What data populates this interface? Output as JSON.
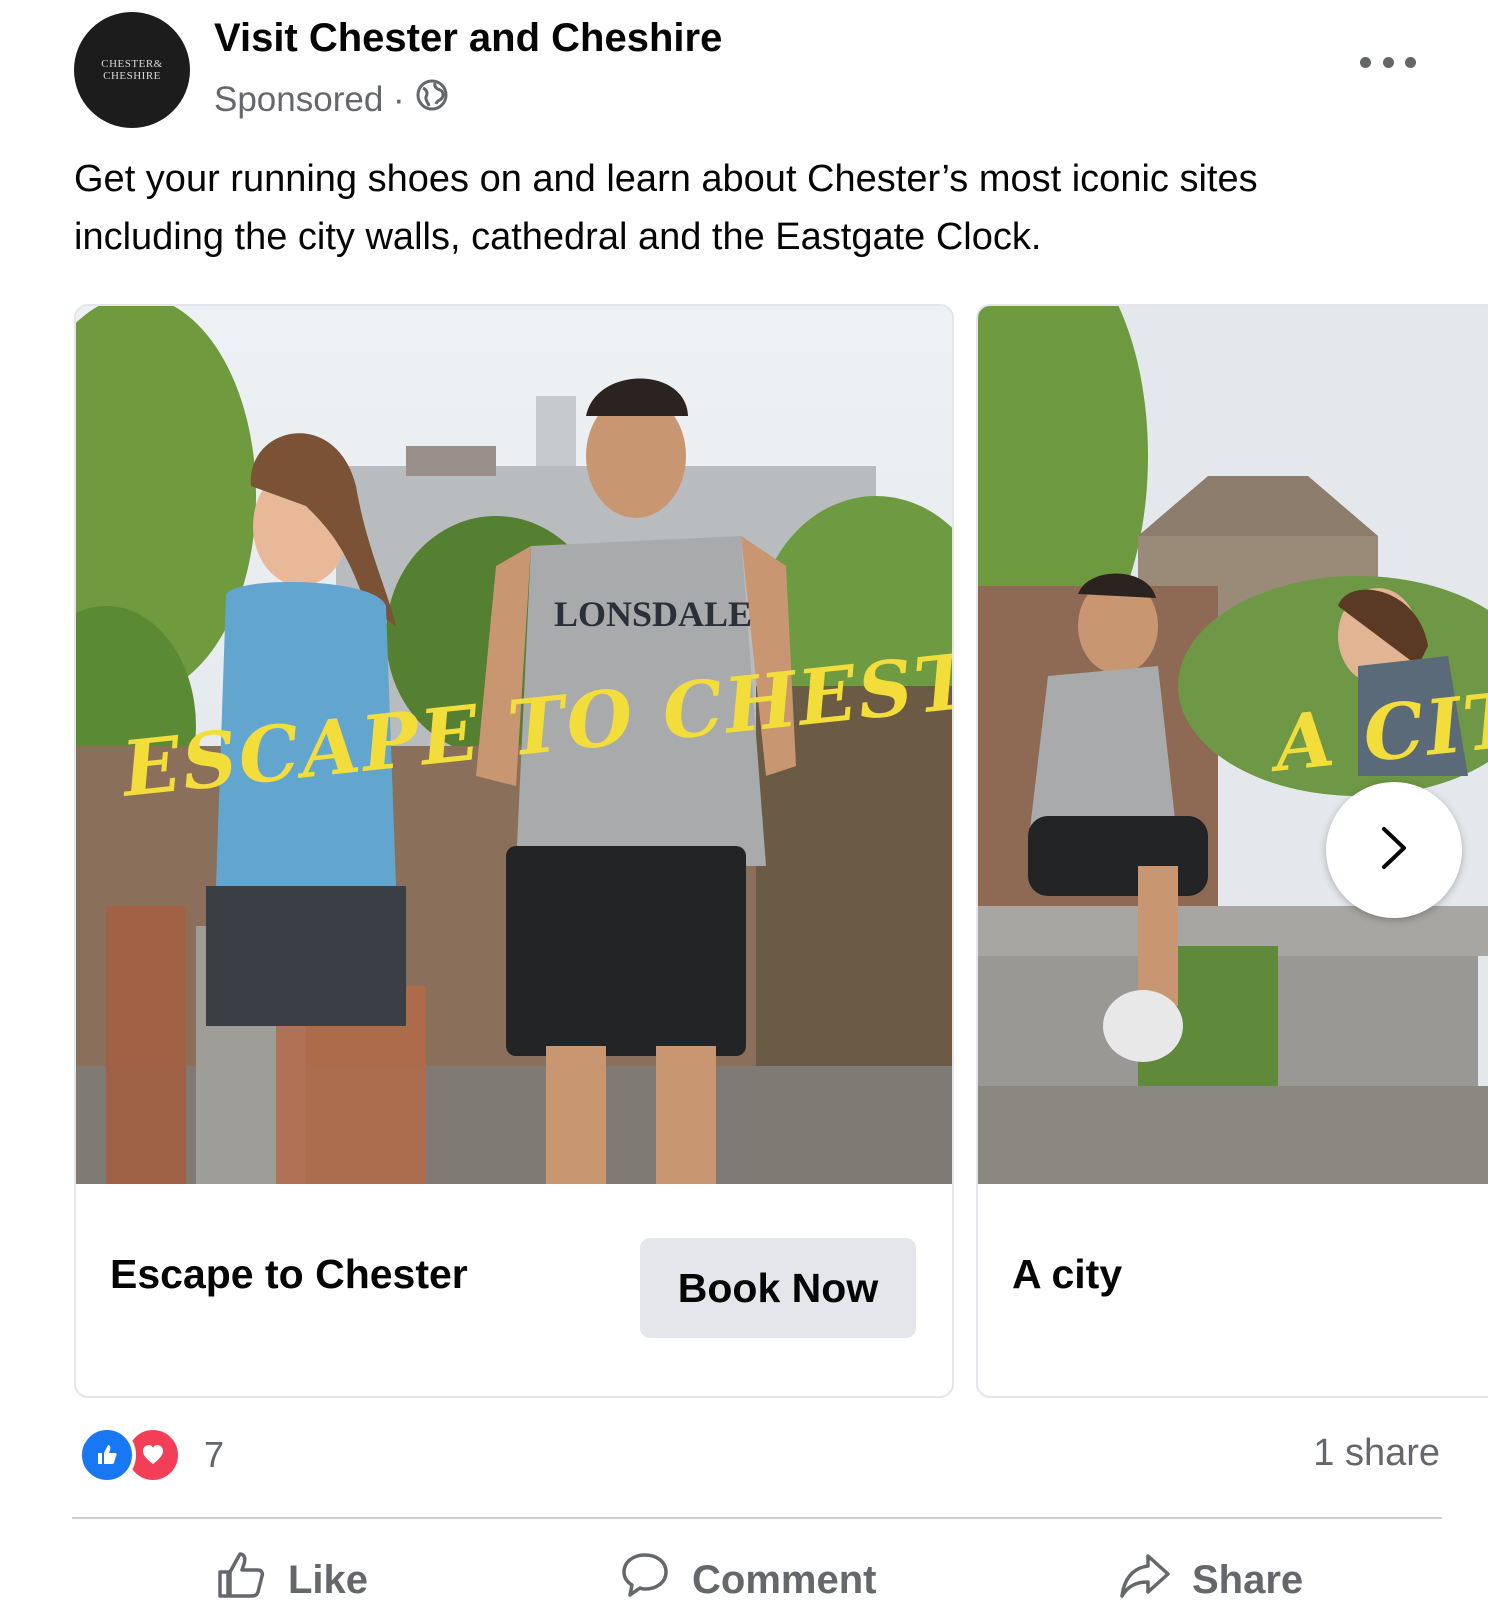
{
  "post": {
    "avatar_line1": "CHESTER&",
    "avatar_line2": "CHESHIRE",
    "page_name": "Visit Chester and Cheshire",
    "sponsored_label": "Sponsored ·",
    "audience_icon": "globe-icon",
    "more_icon": "more-options-icon",
    "caption": "Get your running shoes on and learn about Chester’s most iconic sites including the city walls, cathedral and the Eastgate Clock."
  },
  "carousel": {
    "cards": [
      {
        "image_overlay": "ESCAPE TO CHESTER",
        "shirt_text": "LONSDALE",
        "headline": "Escape to Chester",
        "cta_label": "Book Now"
      },
      {
        "image_overlay": "A CITY",
        "headline": "A city"
      }
    ],
    "next_icon": "chevron-right-icon"
  },
  "engagement": {
    "reaction_icons": [
      "like-reaction-icon",
      "love-reaction-icon"
    ],
    "reaction_count": "7",
    "share_count": "1 share"
  },
  "actions": {
    "like_label": "Like",
    "comment_label": "Comment",
    "share_label": "Share"
  },
  "colors": {
    "overlay_text": "#f2dd3b",
    "like_blue": "#1877f2",
    "love_red": "#f33e58",
    "secondary_text": "#65676b"
  }
}
